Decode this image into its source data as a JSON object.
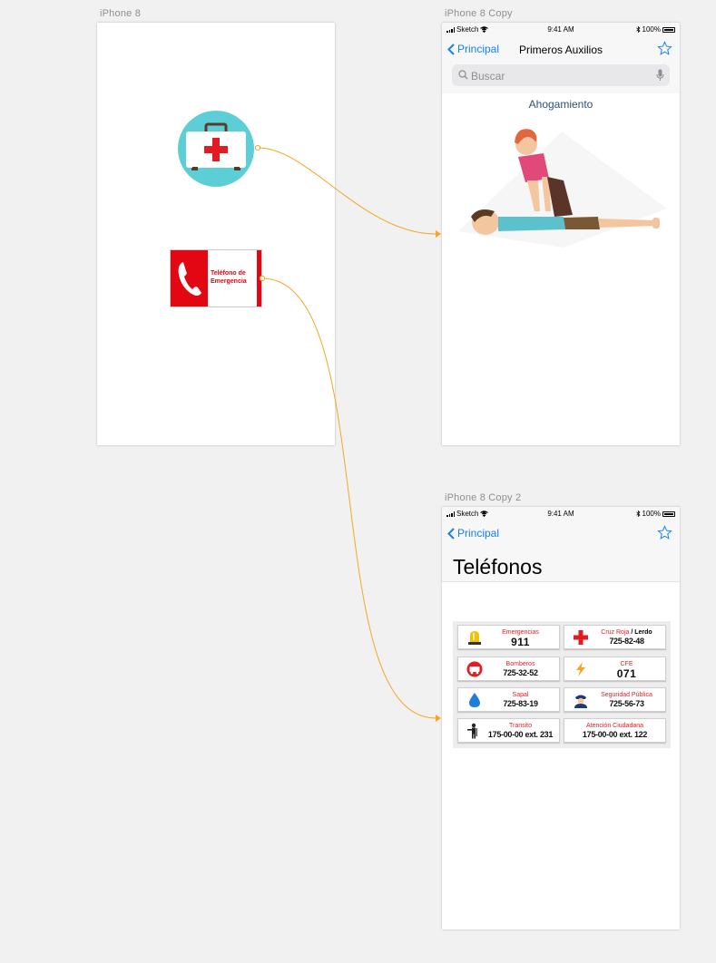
{
  "artboards": [
    {
      "title": "iPhone 8"
    },
    {
      "title": "iPhone 8 Copy"
    },
    {
      "title": "iPhone 8 Copy 2"
    }
  ],
  "home": {
    "phone_button_text": [
      "Teléfono de",
      "Emergencia"
    ]
  },
  "status_bar": {
    "carrier": "Sketch",
    "time": "9:41 AM",
    "battery": "100%"
  },
  "first_aid": {
    "back_label": "Principal",
    "title": "Primeros Auxilios",
    "search_placeholder": "Buscar",
    "section_title": "Ahogamiento"
  },
  "phones": {
    "back_label": "Principal",
    "title": "Teléfonos",
    "entries": [
      {
        "icon": "siren-icon",
        "label": "Emergencias",
        "number": "911"
      },
      {
        "icon": "red-cross-icon",
        "label": "Cruz Roja",
        "extra": "/ Lerdo",
        "number": "725-82-48"
      },
      {
        "icon": "fire-truck-icon",
        "label": "Bomberos",
        "number": "725-32-52"
      },
      {
        "icon": "lightning-icon",
        "label": "CFE",
        "number": "071"
      },
      {
        "icon": "water-drop-icon",
        "label": "Sapal",
        "number": "725-83-19"
      },
      {
        "icon": "police-officer-icon",
        "label": "Seguridad Pública",
        "number": "725-56-73"
      },
      {
        "icon": "traffic-officer-icon",
        "label": "Transito",
        "number": "175-00-00 ext. 231"
      },
      {
        "icon": "",
        "label": "Atención Ciudadana",
        "number": "175-00-00 ext. 122"
      }
    ]
  },
  "colors": {
    "ios_blue": "#157efb",
    "flow_arrow": "#f5a623",
    "accent_red": "#e30613",
    "teal": "#5ccfd6"
  }
}
